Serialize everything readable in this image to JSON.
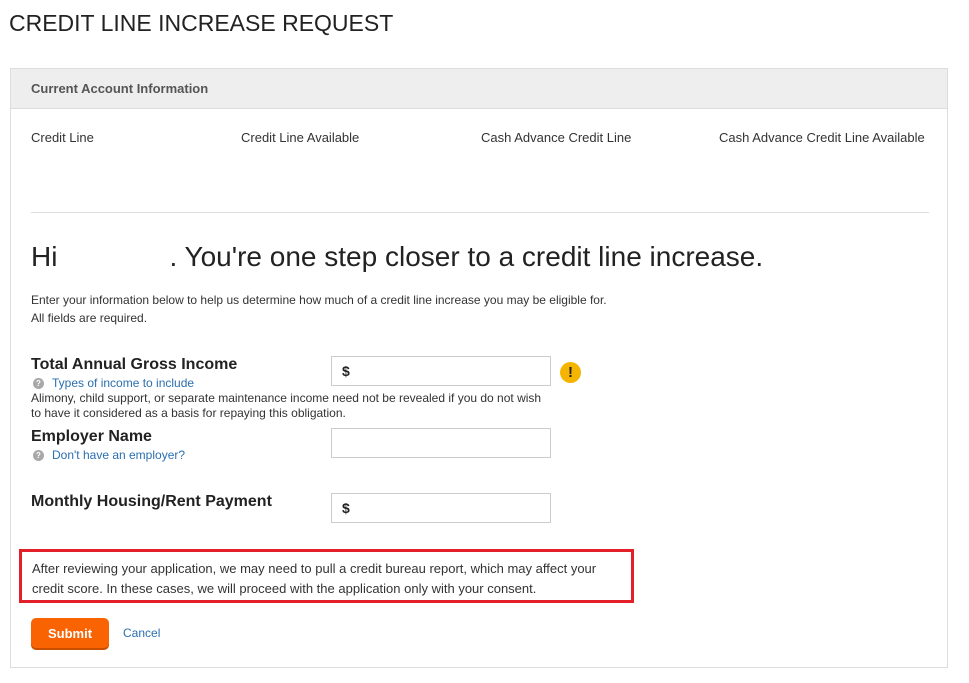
{
  "page": {
    "title": "CREDIT LINE INCREASE REQUEST"
  },
  "account": {
    "header": "Current Account Information",
    "columns": [
      {
        "label": "Credit Line"
      },
      {
        "label": "Credit Line Available"
      },
      {
        "label": "Cash Advance Credit Line"
      },
      {
        "label": "Cash Advance Credit Line Available"
      }
    ]
  },
  "greeting": {
    "prefix": "Hi",
    "name": "",
    "suffix": ". You're one step closer to a credit line increase."
  },
  "intro": {
    "line1": "Enter your information below to help us determine how much of a credit line increase you may be eligible for.",
    "line2": "All fields are required."
  },
  "form": {
    "income": {
      "label": "Total Annual Gross Income",
      "help_link": "Types of income to include",
      "note": "Alimony, child support, or separate maintenance income need not be revealed if you do not wish to have it considered as a basis for repaying this obligation.",
      "prefix": "$",
      "value": "",
      "alert_icon": "exclamation-icon",
      "alert_color": "#f5b400"
    },
    "employer": {
      "label": "Employer Name",
      "help_link": "Don't have an employer?",
      "value": ""
    },
    "housing": {
      "label": "Monthly Housing/Rent Payment",
      "prefix": "$",
      "value": ""
    },
    "help_icon_glyph": "?"
  },
  "disclosure": {
    "text": "After reviewing your application, we may need to pull a credit bureau report, which may affect your credit score. In these cases, we will proceed with the application only with your consent.",
    "highlight_color": "#e3202a"
  },
  "actions": {
    "submit_label": "Submit",
    "cancel_label": "Cancel",
    "submit_color": "#f96302"
  }
}
